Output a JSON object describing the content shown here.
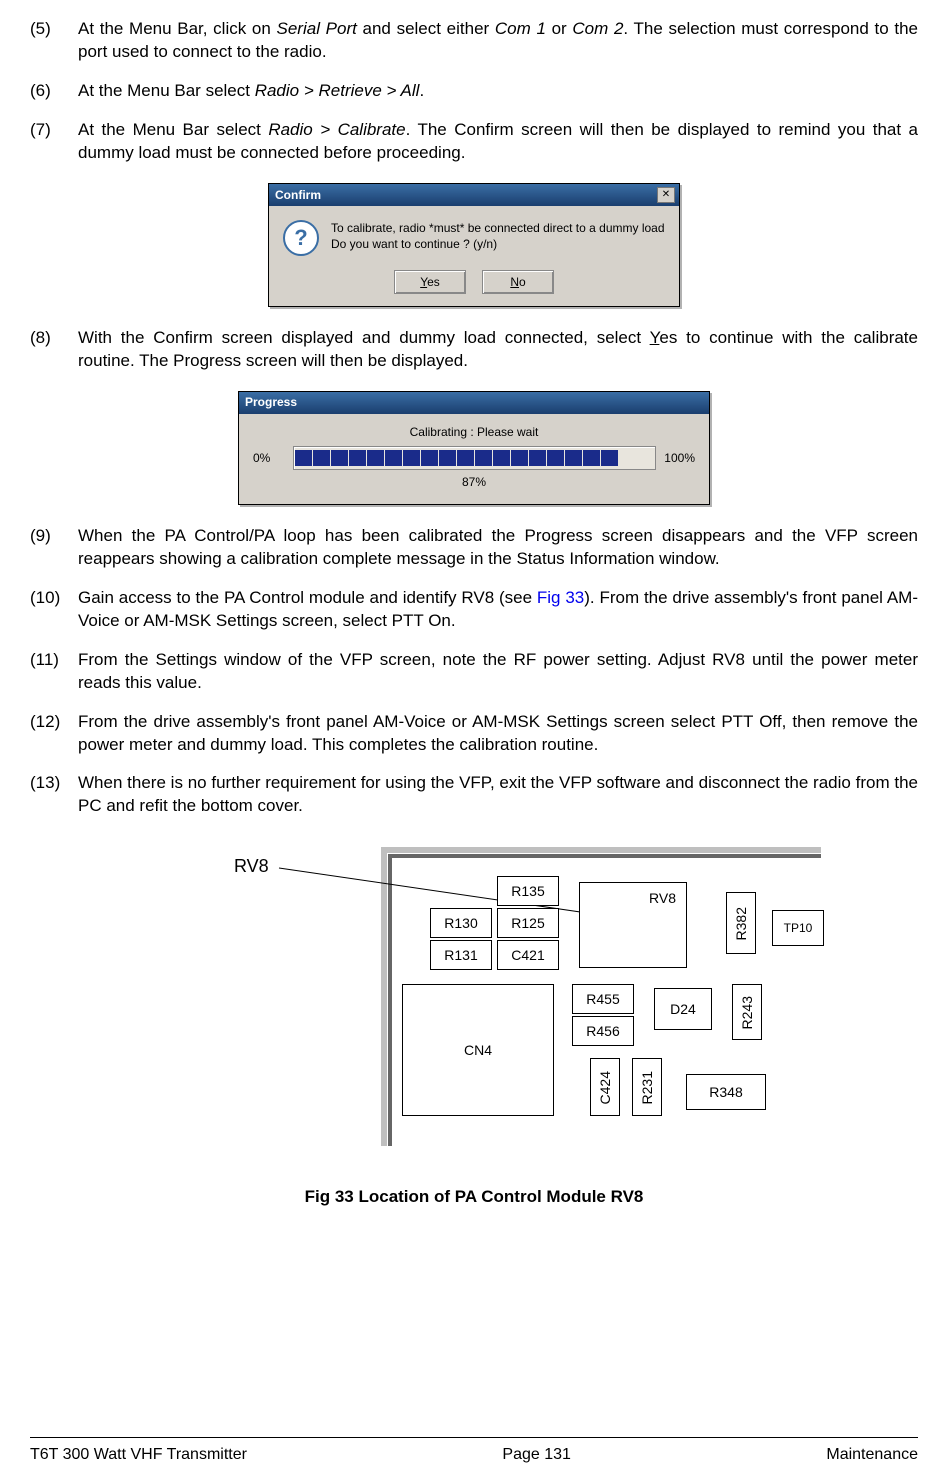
{
  "steps": {
    "s5": {
      "num": "(5)",
      "pre": "At the Menu Bar, click on ",
      "i1": "Serial Port",
      "mid1": " and select either ",
      "i2": "Com 1",
      "mid2": " or ",
      "i3": "Com 2",
      "post": ". The selection must correspond to the port used to connect to the radio."
    },
    "s6": {
      "num": "(6)",
      "pre": "At the Menu Bar select ",
      "i1": "Radio > Retrieve > All",
      "post": "."
    },
    "s7": {
      "num": "(7)",
      "pre": "At the Menu Bar select ",
      "i1": "Radio > Calibrate",
      "post": ". The Confirm screen will then be displayed to remind you that a dummy load must be connected before proceeding."
    },
    "s8": {
      "num": "(8)",
      "pre": "With the Confirm screen displayed and dummy load connected, select ",
      "u1": "Y",
      "post_u": "es to continue with the calibrate routine. The Progress screen will then be displayed."
    },
    "s9": {
      "num": "(9)",
      "text": "When the PA Control/PA loop has been calibrated the Progress screen disappears and the VFP screen reappears showing a calibration complete message in the Status Information window."
    },
    "s10": {
      "num": "(10)",
      "pre": "Gain access to the PA Control module and identify RV8 (see ",
      "link": "Fig 33",
      "post": "). From the drive assembly's front panel AM-Voice or AM-MSK Settings screen, select PTT On."
    },
    "s11": {
      "num": "(11)",
      "text": "From the Settings window of the VFP screen, note the RF power setting. Adjust RV8 until the power meter reads this value."
    },
    "s12": {
      "num": "(12)",
      "text": "From the drive assembly's front panel AM-Voice or AM-MSK Settings screen select PTT Off, then remove the power meter and dummy load. This completes the calibration routine."
    },
    "s13": {
      "num": "(13)",
      "text": "When there is no further requirement for using the VFP, exit the VFP software and disconnect the radio from the PC and refit the bottom cover."
    }
  },
  "confirm_dialog": {
    "title": "Confirm",
    "message_line1": "To calibrate, radio *must* be connected direct to a dummy load",
    "message_line2": "Do you want to continue ? (y/n)",
    "btn_yes_u": "Y",
    "btn_yes_rest": "es",
    "btn_no_u": "N",
    "btn_no_rest": "o"
  },
  "progress_dialog": {
    "title": "Progress",
    "status": "Calibrating : Please wait",
    "left": "0%",
    "right": "100%",
    "under": "87%",
    "segments_total": 20,
    "segments_on": 18
  },
  "fig33": {
    "pointer_label": "RV8",
    "labels": {
      "R135": "R135",
      "R130": "R130",
      "R125": "R125",
      "R131": "R131",
      "C421": "C421",
      "RV8": "RV8",
      "R382": "R382",
      "TP10": "TP10",
      "R455": "R455",
      "R456": "R456",
      "D24": "D24",
      "R243": "R243",
      "CN4": "CN4",
      "C424": "C424",
      "R231": "R231",
      "R348": "R348"
    },
    "caption": "Fig 33  Location of PA Control Module RV8"
  },
  "footer": {
    "left": "T6T 300 Watt VHF Transmitter",
    "center": "Page 131",
    "right": "Maintenance"
  }
}
